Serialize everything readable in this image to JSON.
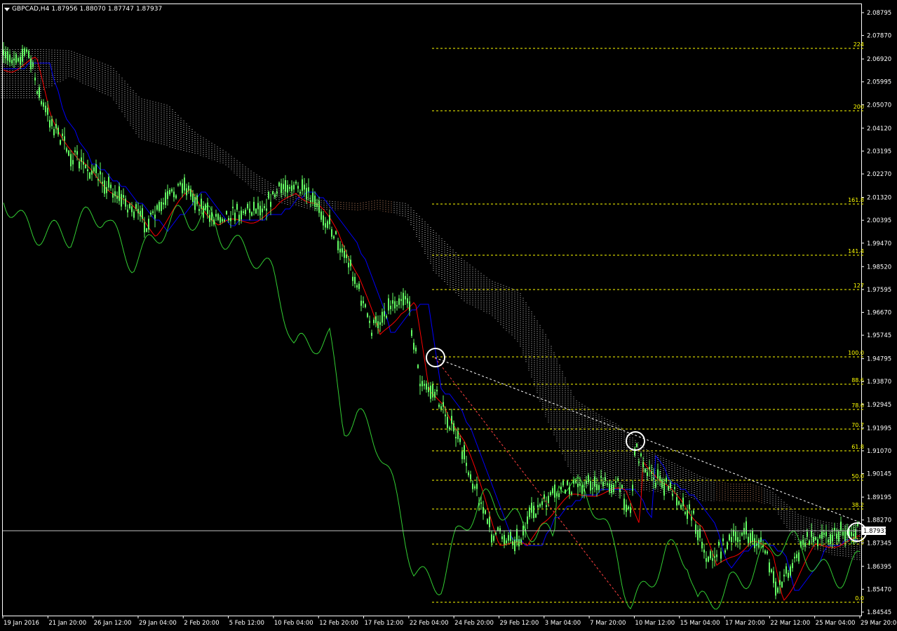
{
  "header": {
    "symbol": "GBPCAD,H4",
    "open": "1.87956",
    "high": "1.88070",
    "low": "1.87747",
    "close": "1.87937"
  },
  "current_price": "1.87937",
  "colors": {
    "background": "#000000",
    "candles": "#64FF64",
    "chikou": "#32CD32",
    "tenkan": "#FF0000",
    "kijun": "#0000FF",
    "cloud": "#FFFFFF",
    "fib": "#FFFF00",
    "axis": "#FFFFFF"
  },
  "price_axis": [
    "2.08795",
    "2.07870",
    "2.06920",
    "2.05995",
    "2.05070",
    "2.04120",
    "2.03195",
    "2.02270",
    "2.01320",
    "2.00395",
    "1.99470",
    "1.98520",
    "1.97595",
    "1.96670",
    "1.95745",
    "1.94795",
    "1.93870",
    "1.92945",
    "1.91995",
    "1.91070",
    "1.90145",
    "1.89195",
    "1.88270",
    "1.87345",
    "1.86395",
    "1.85470",
    "1.84545"
  ],
  "time_axis": [
    "19 Jan 2016",
    "21 Jan 20:00",
    "26 Jan 12:00",
    "29 Jan 04:00",
    "2 Feb 20:00",
    "5 Feb 12:00",
    "10 Feb 04:00",
    "12 Feb 20:00",
    "17 Feb 12:00",
    "22 Feb 04:00",
    "24 Feb 20:00",
    "29 Feb 12:00",
    "3 Mar 04:00",
    "7 Mar 20:00",
    "10 Mar 12:00",
    "15 Mar 04:00",
    "17 Mar 20:00",
    "22 Mar 12:00",
    "25 Mar 04:00",
    "29 Mar 20:00"
  ],
  "fib_levels": [
    "224",
    "200",
    "161.8",
    "141.4",
    "127",
    "100.0",
    "88.6",
    "78.6",
    "70.7",
    "61.8",
    "50.0",
    "38.2",
    "23.6",
    "0.0"
  ],
  "chart_data": {
    "type": "line",
    "title": "GBPCAD,H4",
    "xlabel": "",
    "ylabel": "",
    "ylim": [
      1.84545,
      2.08795
    ],
    "x": [
      "19 Jan 2016",
      "21 Jan 20:00",
      "26 Jan 12:00",
      "29 Jan 04:00",
      "2 Feb 20:00",
      "5 Feb 12:00",
      "10 Feb 04:00",
      "12 Feb 20:00",
      "17 Feb 12:00",
      "22 Feb 04:00",
      "24 Feb 20:00",
      "29 Feb 12:00",
      "3 Mar 04:00",
      "7 Mar 20:00",
      "10 Mar 12:00",
      "15 Mar 04:00",
      "17 Mar 20:00",
      "22 Mar 12:00",
      "25 Mar 04:00",
      "29 Mar 20:00"
    ],
    "series": [
      {
        "values": [
          2.067,
          2.035,
          2.025,
          2.008,
          2.01,
          2.005,
          2.022,
          2.01,
          1.978,
          1.935,
          1.905,
          1.876,
          1.894,
          1.897,
          1.912,
          1.893,
          1.88,
          1.86,
          1.874,
          1.8794
        ]
      }
    ],
    "grid": false,
    "legend": "none"
  }
}
